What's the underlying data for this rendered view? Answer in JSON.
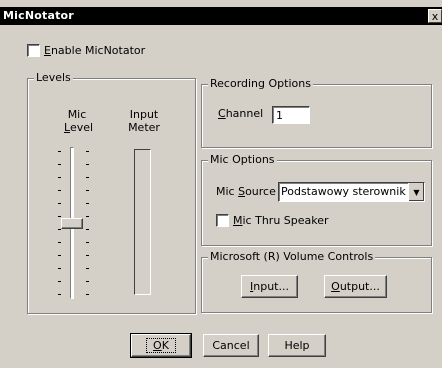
{
  "window": {
    "title": "MicNotator",
    "close_label": "x"
  },
  "enable_checkbox": {
    "label_first": "E",
    "label_rest": "nable MicNotator",
    "checked": false
  },
  "levels": {
    "title": "Levels",
    "mic_label_line1": "Mic",
    "mic_label_line2_first": "L",
    "mic_label_line2_rest": "evel",
    "meter_label_line1": "Input",
    "meter_label_line2": "Meter"
  },
  "recording_options": {
    "title": "Recording Options",
    "channel_label_first": "C",
    "channel_label_rest": "hannel",
    "channel_value": "1"
  },
  "mic_options": {
    "title": "Mic Options",
    "source_label_prefix": "Mic ",
    "source_label_first": "S",
    "source_label_rest": "ource",
    "source_value": "Podstawowy sterownik pr",
    "thru_label_first": "M",
    "thru_label_rest": "ic Thru Speaker",
    "thru_checked": false
  },
  "volume_controls": {
    "title": "Microsoft (R) Volume Controls",
    "input_first": "I",
    "input_rest": "nput...",
    "output_first": "O",
    "output_rest": "utput..."
  },
  "footer": {
    "ok_first": "O",
    "ok_rest": "K",
    "cancel": "Cancel",
    "help": "Help"
  }
}
